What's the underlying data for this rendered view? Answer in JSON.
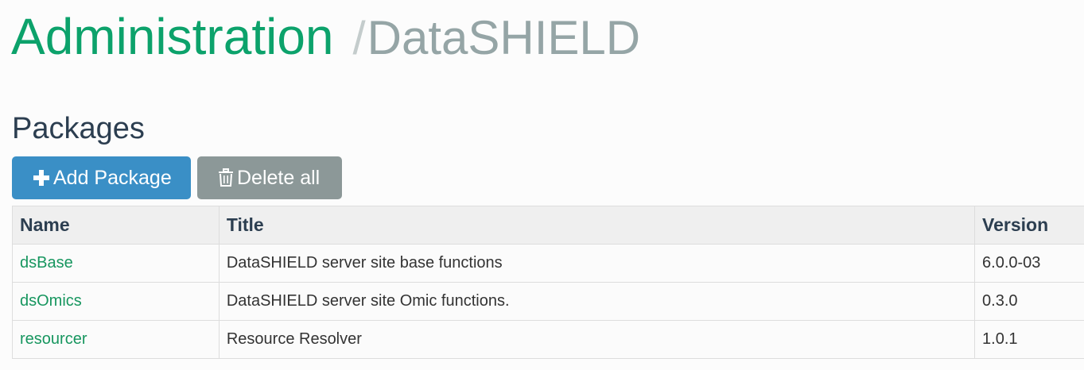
{
  "breadcrumb": {
    "root": "Administration",
    "separator": "/",
    "current": "DataSHIELD"
  },
  "section": {
    "title": "Packages"
  },
  "toolbar": {
    "add_label": "Add Package",
    "add_icon": "plus-icon",
    "delete_label": "Delete all",
    "delete_icon": "trash-icon"
  },
  "table": {
    "headers": {
      "name": "Name",
      "title": "Title",
      "version": "Version"
    },
    "rows": [
      {
        "name": "dsBase",
        "title": "DataSHIELD server site base functions",
        "version": "6.0.0-03"
      },
      {
        "name": "dsOmics",
        "title": "DataSHIELD server site Omic functions.",
        "version": "0.3.0"
      },
      {
        "name": "resourcer",
        "title": "Resource Resolver",
        "version": "1.0.1"
      }
    ]
  },
  "colors": {
    "brand_green": "#0ca26b",
    "link_green": "#17965f",
    "primary_button": "#3a8fc6",
    "default_button": "#8c9898",
    "heading": "#2c3e50"
  }
}
